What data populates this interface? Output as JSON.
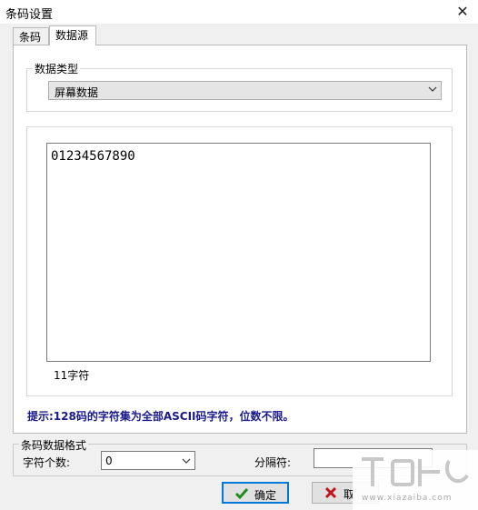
{
  "window": {
    "title": "条码设置",
    "close_glyph": "✕"
  },
  "tabs": [
    {
      "label": "条码"
    },
    {
      "label": "数据源"
    }
  ],
  "data_type": {
    "legend": "数据类型",
    "selected": "屏幕数据"
  },
  "content": {
    "text": "01234567890",
    "char_count": "11字符"
  },
  "hint": "提示:128码的字符集为全部ASCII码字符，位数不限。",
  "format": {
    "legend": "条码数据格式",
    "char_count_label": "字符个数:",
    "char_count_value": "0",
    "separator_label": "分隔符:",
    "separator_value": ""
  },
  "buttons": {
    "ok": "确定",
    "cancel": "取"
  },
  "watermark": {
    "url": "www.xiazaiba.com"
  },
  "colors": {
    "hint": "#1a1a8c",
    "ok_icon": "#1e8a1e",
    "cancel_icon": "#c0161b",
    "default_border": "#0078d7"
  }
}
